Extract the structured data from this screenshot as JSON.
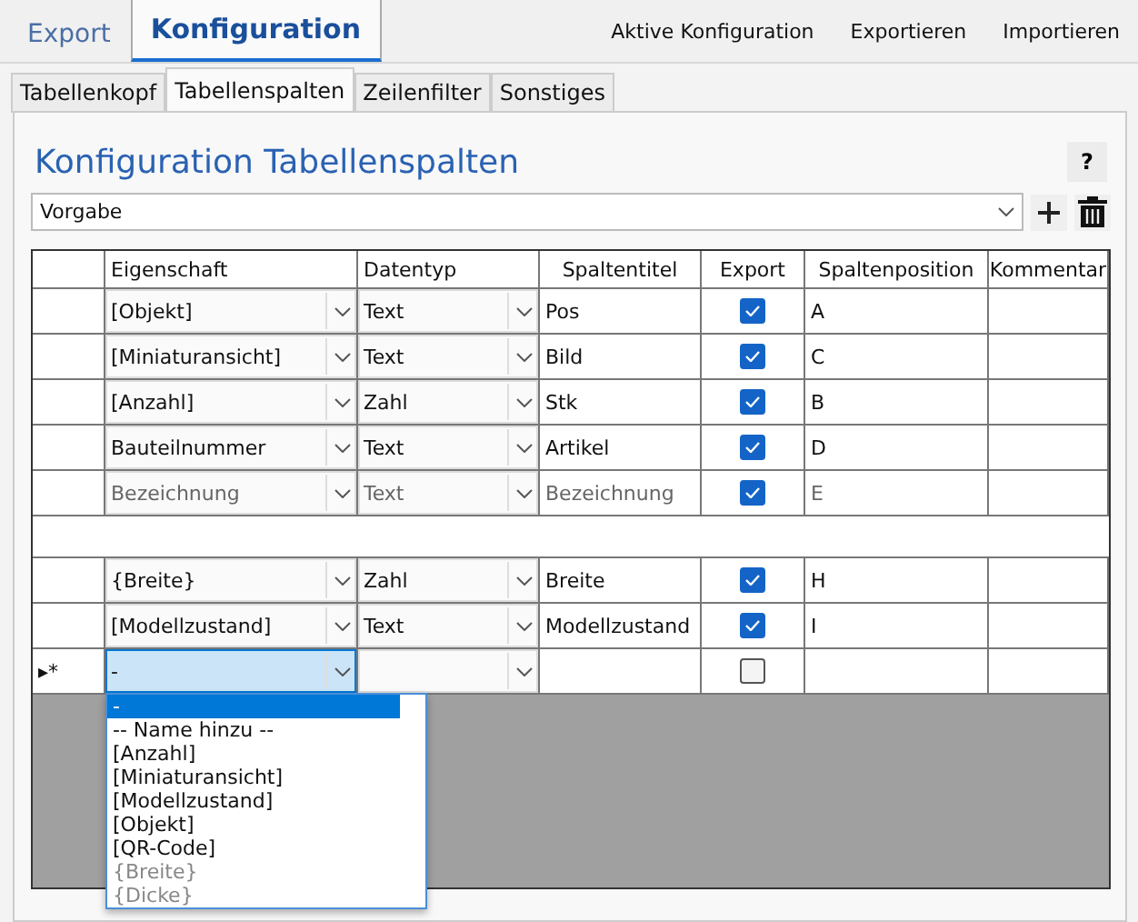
{
  "main_tabs": [
    {
      "label": "Export",
      "selected": false
    },
    {
      "label": "Konfiguration",
      "selected": true
    }
  ],
  "toolbar": [
    "Aktive Konfiguration",
    "Exportieren",
    "Importieren"
  ],
  "sub_tabs": [
    {
      "label": "Tabellenkopf",
      "selected": false
    },
    {
      "label": "Tabellenspalten",
      "selected": true
    },
    {
      "label": "Zeilenfilter",
      "selected": false
    },
    {
      "label": "Sonstiges",
      "selected": false
    }
  ],
  "title": "Konfiguration Tabellenspalten",
  "help": "?",
  "preset": {
    "value": "Vorgabe"
  },
  "table": {
    "columns": [
      "Eigenschaft",
      "Datentyp",
      "Spaltentitel",
      "Export",
      "Spaltenposition",
      "Kommentar"
    ],
    "rows_top": [
      {
        "property": "[Objekt]",
        "type": "Text",
        "title": "Pos",
        "export": true,
        "position": "A",
        "faded": false
      },
      {
        "property": "[Miniaturansicht]",
        "type": "Text",
        "title": "Bild",
        "export": true,
        "position": "C",
        "faded": false
      },
      {
        "property": "[Anzahl]",
        "type": "Zahl",
        "title": "Stk",
        "export": true,
        "position": "B",
        "faded": false
      },
      {
        "property": "Bauteilnummer",
        "type": "Text",
        "title": "Artikel",
        "export": true,
        "position": "D",
        "faded": false
      },
      {
        "property": "Bezeichnung",
        "type": "Text",
        "title": "Bezeichnung",
        "export": true,
        "position": "E",
        "faded": true
      }
    ],
    "rows_bottom": [
      {
        "property": "{Breite}",
        "type": "Zahl",
        "title": "Breite",
        "export": true,
        "position": "H",
        "faded": false
      },
      {
        "property": "[Modellzustand]",
        "type": "Text",
        "title": "Modellzustand",
        "export": true,
        "position": "I",
        "faded": false
      }
    ],
    "new_row": {
      "marker": "▸*",
      "property": "-",
      "export": false
    }
  },
  "dropdown_options": [
    {
      "label": "-",
      "selected": true,
      "dim": false
    },
    {
      "label": "-- Name hinzu --",
      "selected": false,
      "dim": false
    },
    {
      "label": "[Anzahl]",
      "selected": false,
      "dim": false
    },
    {
      "label": "[Miniaturansicht]",
      "selected": false,
      "dim": false
    },
    {
      "label": "[Modellzustand]",
      "selected": false,
      "dim": false
    },
    {
      "label": "[Objekt]",
      "selected": false,
      "dim": false
    },
    {
      "label": "[QR-Code]",
      "selected": false,
      "dim": false
    },
    {
      "label": "{Breite}",
      "selected": false,
      "dim": true
    },
    {
      "label": "{Dicke}",
      "selected": false,
      "dim": true
    }
  ]
}
